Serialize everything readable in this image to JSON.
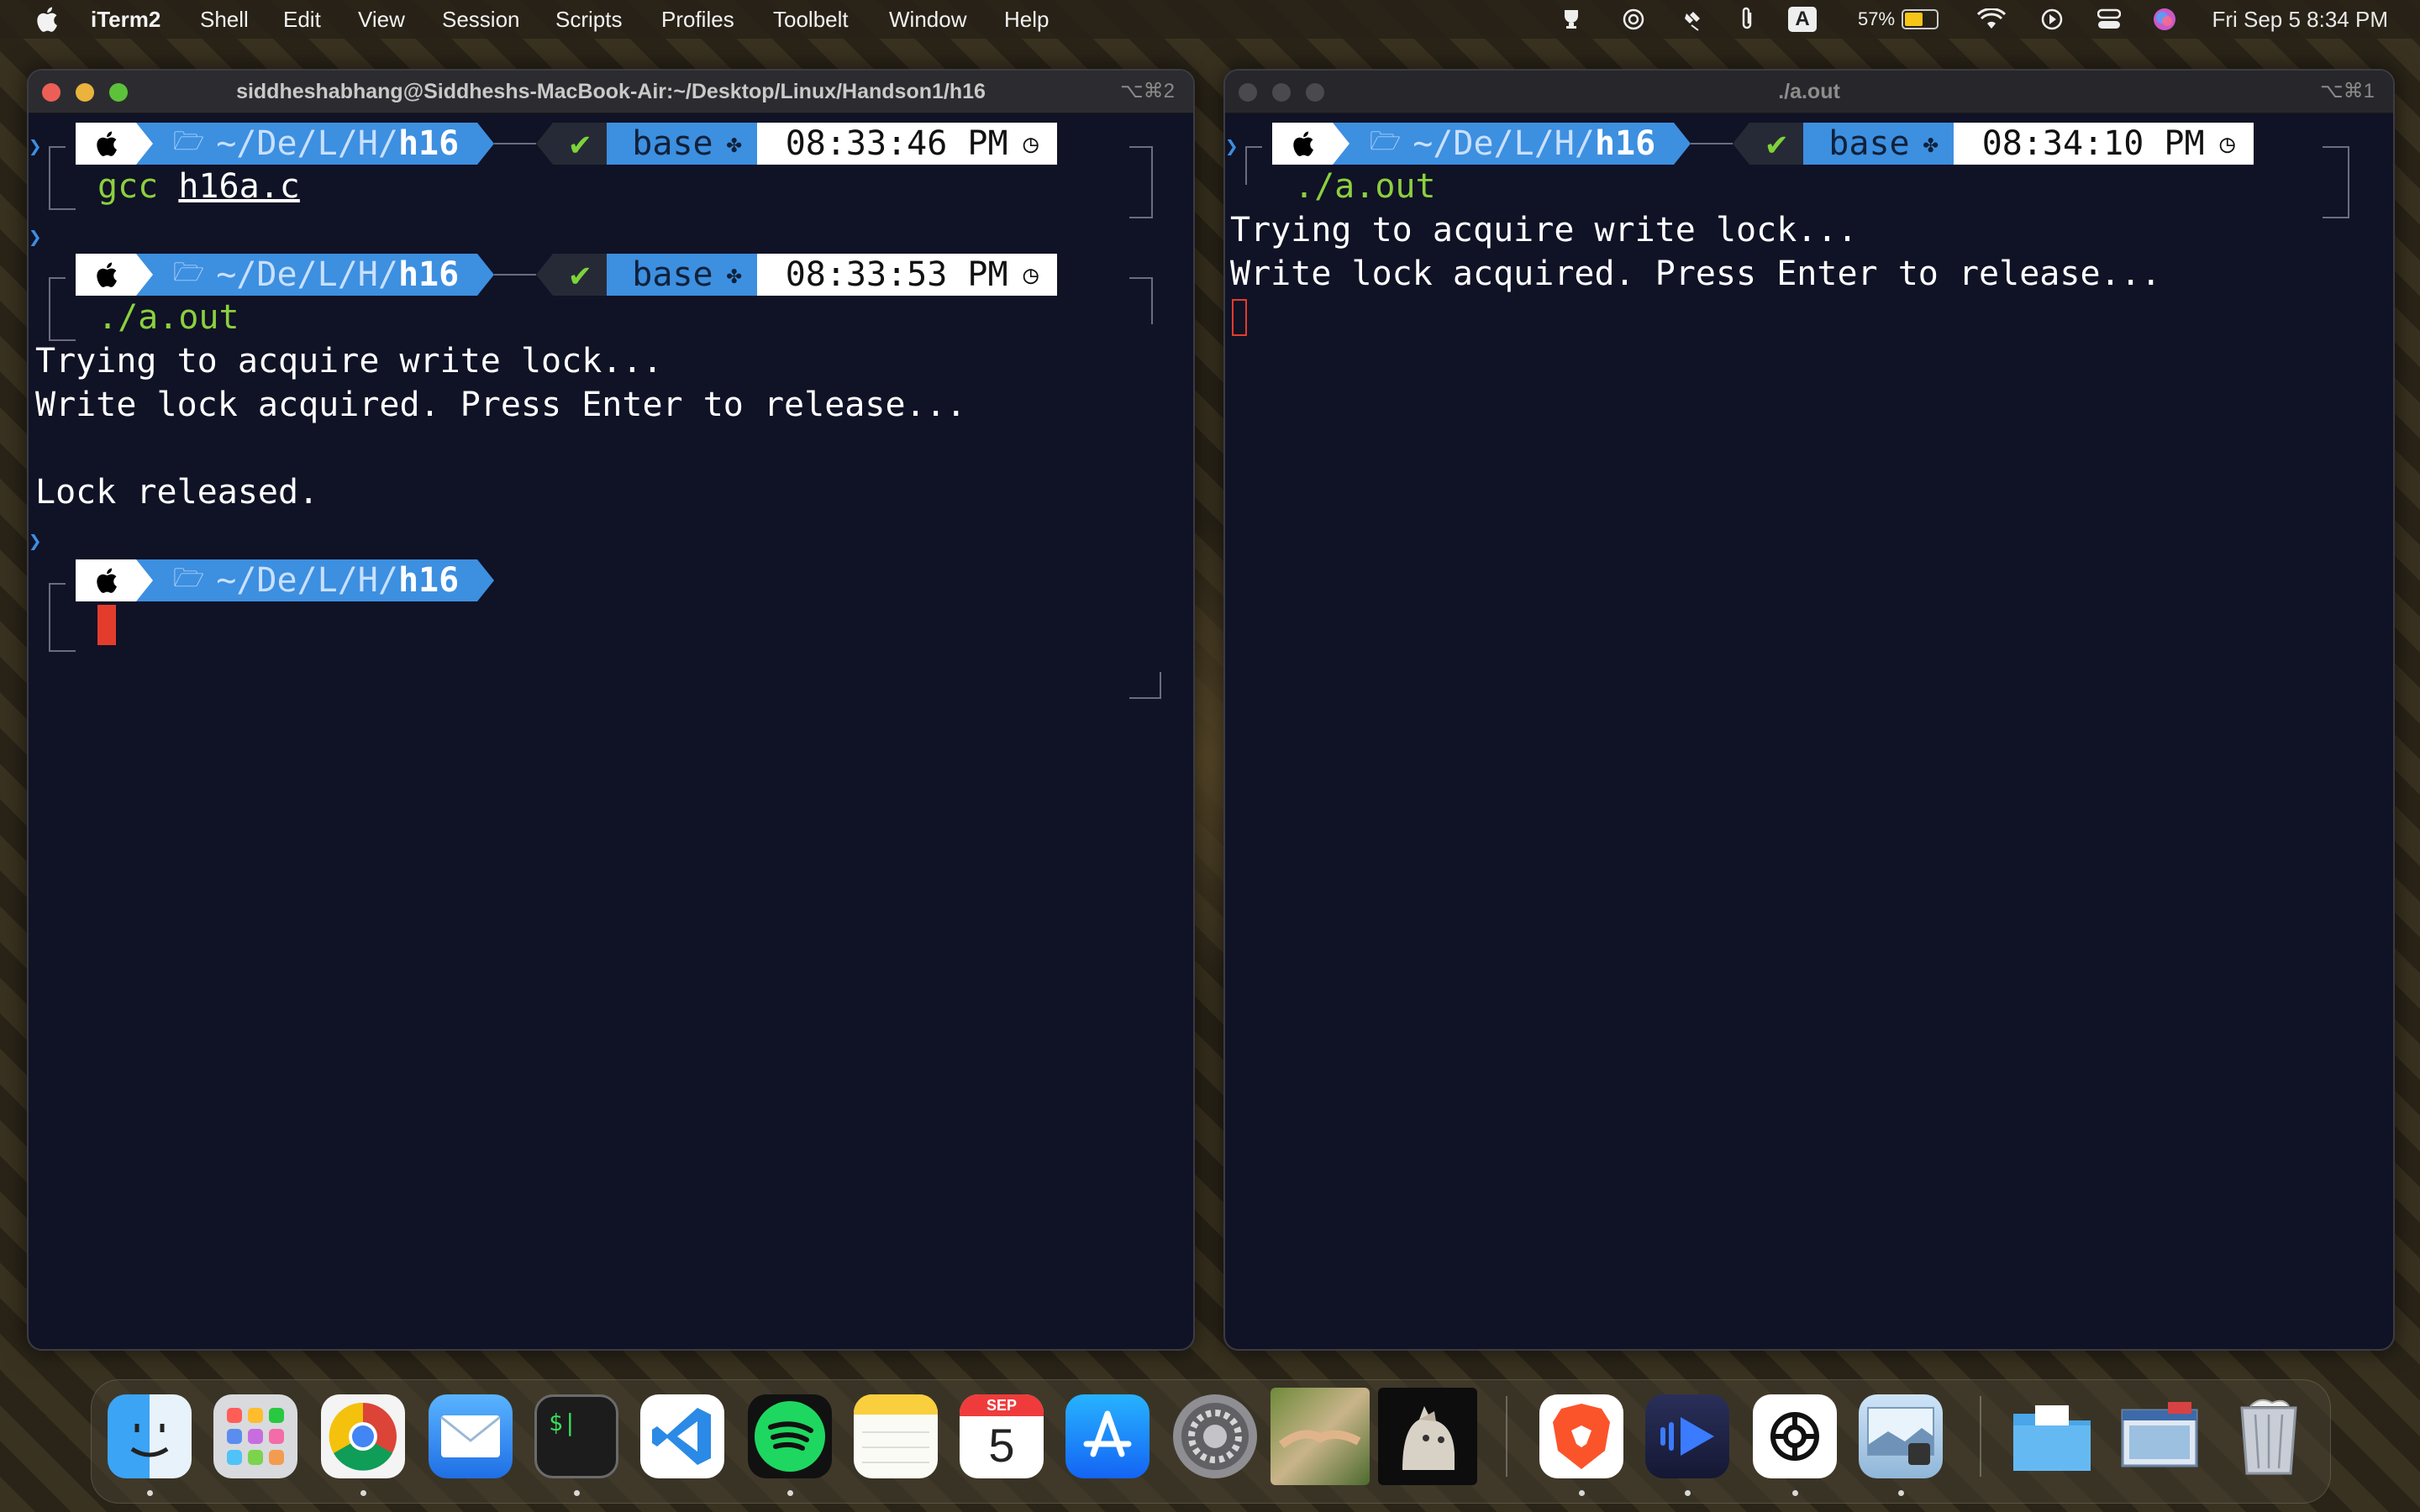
{
  "menubar": {
    "app_name": "iTerm2",
    "items": [
      "Shell",
      "Edit",
      "View",
      "Session",
      "Scripts",
      "Profiles",
      "Toolbelt",
      "Window",
      "Help"
    ],
    "keyboard_indicator": "A",
    "battery_percent": "57%",
    "battery_level": 0.57,
    "clock": "Fri Sep 5  8:34 PM"
  },
  "left_window": {
    "title": "siddheshabhang@Siddheshs-MacBook-Air:~/Desktop/Linux/Handson1/h16",
    "shortcut": "⌥⌘2",
    "prompts": [
      {
        "dir_prefix": "~/",
        "dir_parts": "De/L/H/",
        "dir_last": "h16",
        "check": "✔",
        "env": "base",
        "time": "08:33:46 PM"
      },
      {
        "dir_prefix": "~/",
        "dir_parts": "De/L/H/",
        "dir_last": "h16",
        "check": "✔",
        "env": "base",
        "time": "08:33:53 PM"
      },
      {
        "dir_prefix": "~/",
        "dir_parts": "De/L/H/",
        "dir_last": "h16"
      }
    ],
    "cmd1_name": "gcc",
    "cmd1_arg": "h16a.c",
    "cmd2": "./a.out",
    "output": [
      "Trying to acquire write lock...",
      "Write lock acquired. Press Enter to release...",
      "",
      "Lock released."
    ]
  },
  "right_window": {
    "title": "./a.out",
    "shortcut": "⌥⌘1",
    "prompt": {
      "dir_prefix": "~/",
      "dir_parts": "De/L/H/",
      "dir_last": "h16",
      "check": "✔",
      "env": "base",
      "time": "08:34:10 PM"
    },
    "cmd": "./a.out",
    "output": [
      "Trying to acquire write lock...",
      "Write lock acquired. Press Enter to release..."
    ]
  },
  "dock": {
    "calendar_month": "SEP",
    "calendar_day": "5",
    "terminal_glyph": "$|"
  },
  "colors": {
    "terminal_bg": "#101226",
    "powerline_blue": "#3d8fe0",
    "command_green": "#8bd03e",
    "cursor_red": "#e43c2c"
  }
}
